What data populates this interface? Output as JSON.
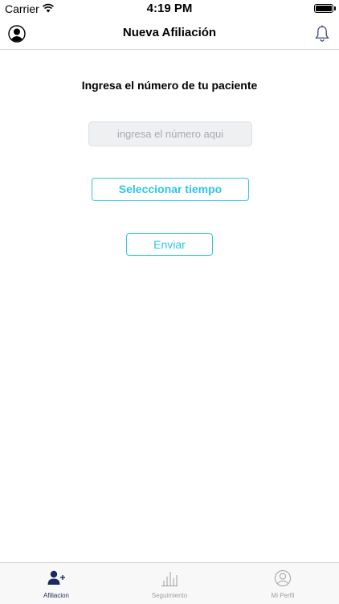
{
  "status_bar": {
    "carrier": "Carrier",
    "time": "4:19 PM",
    "icons": [
      "wifi-icon",
      "battery-icon"
    ]
  },
  "nav_bar": {
    "title": "Nueva Afiliación",
    "left_icon": "profile-icon",
    "right_icon": "bell-icon"
  },
  "form": {
    "instruction": "Ingresa el número de tu paciente",
    "number_input": {
      "value": "",
      "placeholder": "ingresa el número aqui"
    },
    "select_time_label": "Seleccionar tiempo",
    "send_label": "Enviar"
  },
  "tab_bar": {
    "tabs": [
      {
        "label": "Afiliacion",
        "icon": "add-person-icon",
        "active": true
      },
      {
        "label": "Seguimiento",
        "icon": "bar-chart-icon",
        "active": false
      },
      {
        "label": "Mi Perfil",
        "icon": "profile-icon",
        "active": false
      }
    ]
  },
  "colors": {
    "accent": "#2dc6e6",
    "active_tab": "#1d2b5c",
    "inactive_tab": "#a0a0a0",
    "input_bg": "#eef0f2"
  }
}
